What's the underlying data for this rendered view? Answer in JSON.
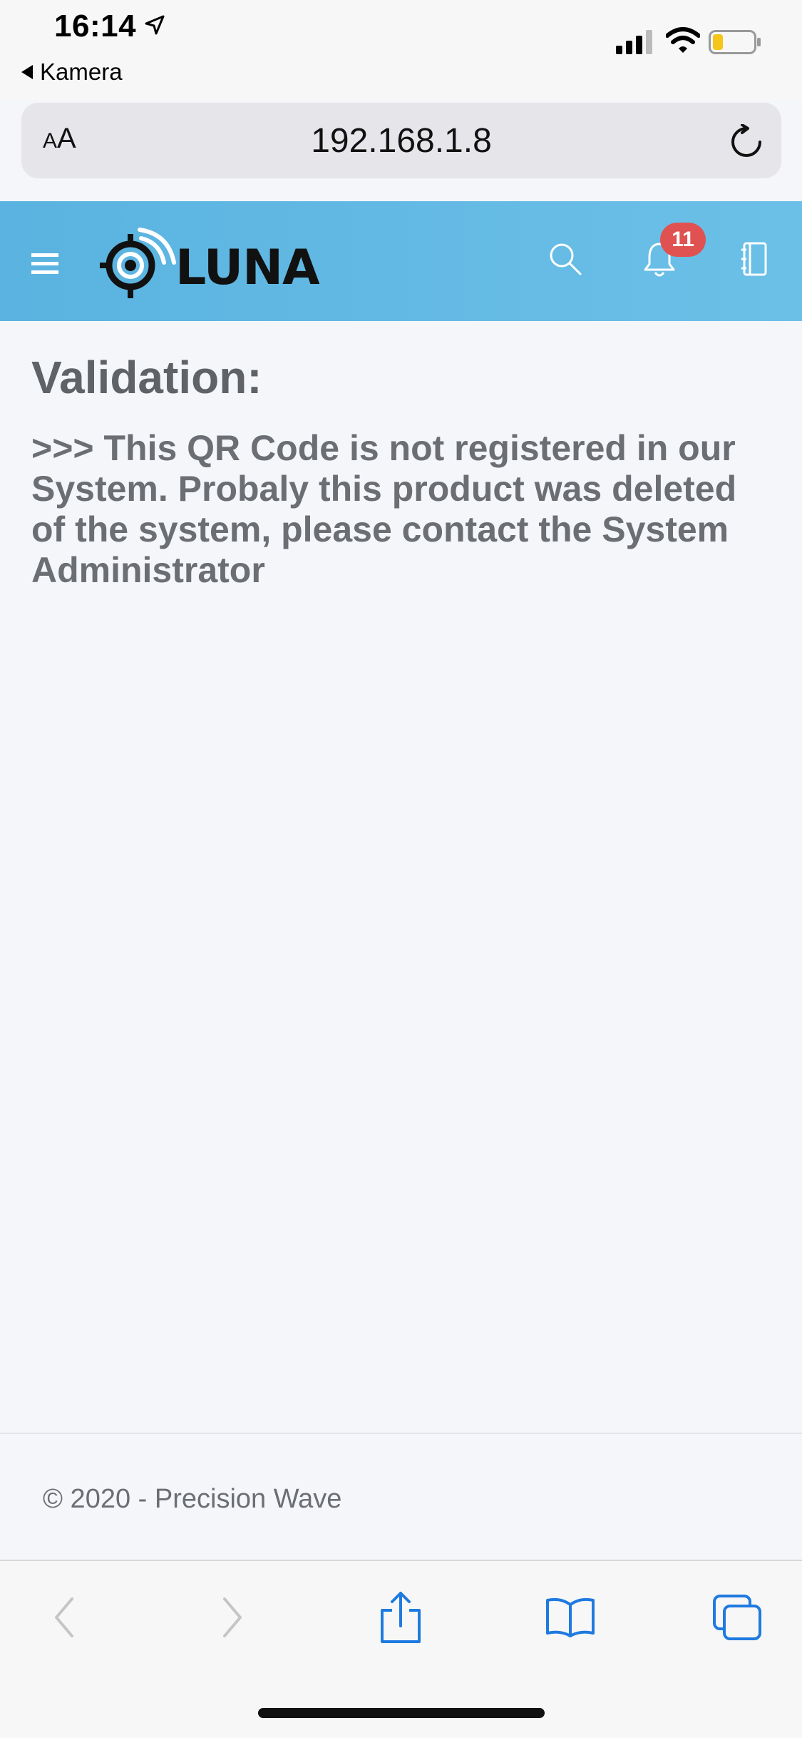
{
  "status_bar": {
    "time": "16:14",
    "back_app": "Kamera",
    "battery_color": "#f5c518"
  },
  "address_bar": {
    "text_size_small": "A",
    "text_size_large": "A",
    "url": "192.168.1.8"
  },
  "header": {
    "brand": "LUNA",
    "notification_count": "11",
    "accent_color": "#5ab3e0",
    "badge_color": "#e05252",
    "icons": [
      "menu-icon",
      "logo-icon",
      "search-icon",
      "bell-icon",
      "book-icon"
    ]
  },
  "main": {
    "title": "Validation:",
    "message": ">>> This QR Code is not registered in our System. Probaly this product was deleted of the system, please contact the System Administrator"
  },
  "footer": {
    "copyright": "© 2020 - Precision Wave"
  },
  "toolbar": {
    "icons": [
      "back-icon",
      "forward-icon",
      "share-icon",
      "bookmarks-icon",
      "tabs-icon"
    ],
    "accent_color": "#1f7ae0"
  }
}
